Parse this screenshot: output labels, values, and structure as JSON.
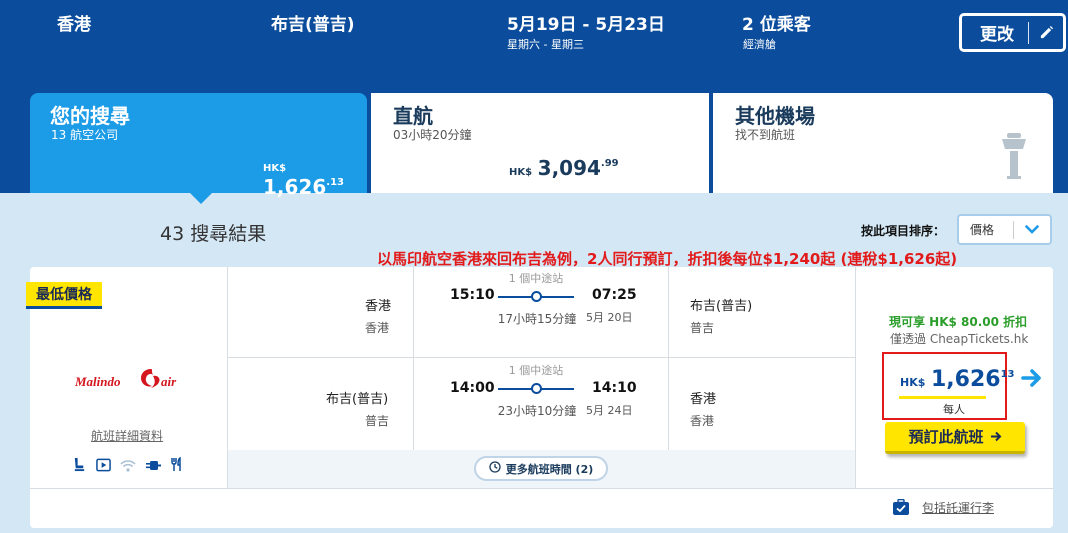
{
  "header": {
    "origin": "香港",
    "destination": "布吉(普吉)",
    "dates": "5月19日 - 5月23日",
    "days": "星期六 - 星期三",
    "passengers": "2 位乘客",
    "cabin": "經濟艙",
    "change_label": "更改"
  },
  "tabs": [
    {
      "title": "您的搜尋",
      "sub": "13 航空公司",
      "currency": "HK$",
      "price": "1,626",
      "price_decimal": ".13"
    },
    {
      "title": "直航",
      "sub": "03小時20分鐘",
      "currency": "HK$",
      "price": "3,094",
      "price_decimal": ".99"
    },
    {
      "title": "其他機場",
      "sub": "找不到航班"
    }
  ],
  "results": {
    "count": "43 搜尋結果",
    "sort_label": "按此項目排序：",
    "sort_value": "價格"
  },
  "promo_text": "以馬印航空香港來回布吉為例，2人同行預訂，折扣後每位$1,240起 (連稅$1,626起)",
  "card": {
    "badge": "最低價格",
    "airline_logo_text": "Malindo air",
    "details_link": "航班詳細資料",
    "amenities": [
      "seat-icon",
      "video-icon",
      "wifi-icon",
      "power-icon",
      "meal-icon"
    ],
    "outbound": {
      "from_city": "香港",
      "from_airport": "香港",
      "dep_time": "15:10",
      "arr_time": "07:25",
      "stops": "1 個中途站",
      "duration": "17小時15分鐘",
      "arr_date": "5月 20日",
      "to_city": "布吉(普吉)",
      "to_airport": "普吉"
    },
    "return": {
      "from_city": "布吉(普吉)",
      "from_airport": "普吉",
      "dep_time": "14:00",
      "arr_time": "14:10",
      "stops": "1 個中途站",
      "duration": "23小時10分鐘",
      "arr_date": "5月 24日",
      "to_city": "香港",
      "to_airport": "香港"
    },
    "more_times": "更多航班時間 (2)",
    "discount": "現可享 HK$ 80.00 折扣",
    "via": "僅透過 CheapTickets.hk",
    "currency": "HK$",
    "price": "1,626",
    "price_decimal": "13",
    "per_person": "每人",
    "book_label": "預訂此航班",
    "baggage_label": "包括託運行李"
  },
  "colors": {
    "header_bg": "#0b4d9c",
    "tab_active": "#1c9be6",
    "accent_yellow": "#ffe500",
    "promo_red": "#e21a1a",
    "discount_green": "#2a9d2a"
  }
}
